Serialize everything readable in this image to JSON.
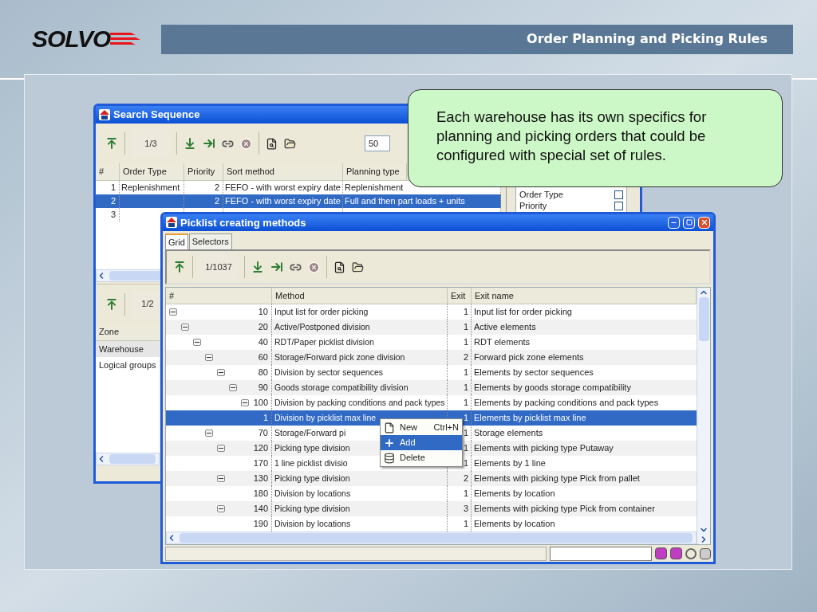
{
  "slide": {
    "logo": "SOLVO",
    "title": "Order Planning and Picking Rules"
  },
  "callout": {
    "text": "Each warehouse has its own specifics for planning and picking orders that could be configured with special set of rules."
  },
  "search_window": {
    "title": "Search Sequence",
    "counter": "1/3",
    "count_field": "50",
    "columns": [
      "#",
      "Order Type",
      "Priority",
      "Sort method",
      "Planning type"
    ],
    "rows": [
      {
        "number": "1",
        "order_type": "Replenishment",
        "priority": "2",
        "sort_method": "FEFO - with worst expiry date",
        "planning_type": "Replenishment",
        "selected": false
      },
      {
        "number": "2",
        "priority": "2",
        "sort_method": "FEFO - with worst expiry date",
        "planning_type": "Full and then part loads + units",
        "selected": true
      },
      {
        "number": "3",
        "selected": false
      }
    ],
    "side_fields": [
      {
        "label": "Order Type",
        "checked": false
      },
      {
        "label": "Priority",
        "checked": false
      }
    ],
    "lower": {
      "counter": "1/2",
      "column": "Zone",
      "items": [
        {
          "label": "Warehouse",
          "selected": true
        },
        {
          "label": "Logical groups",
          "selected": false
        }
      ]
    }
  },
  "picklist_window": {
    "title": "Picklist creating methods",
    "tabs": [
      {
        "label": "Grid",
        "selected": true
      },
      {
        "label": "Selectors",
        "selected": false
      }
    ],
    "counter": "1/1037",
    "columns": [
      "#",
      "Method",
      "Exit",
      "Exit name"
    ],
    "rows": [
      {
        "number": "10",
        "method": "Input list for order picking",
        "exit": "1",
        "exit_name": "Input list for order picking",
        "selected": false,
        "expanded": true,
        "children": [
          {
            "number": "20",
            "method": "Active/Postponed division",
            "exit": "1",
            "exit_name": "Active elements",
            "selected": false,
            "expanded": true,
            "children": [
              {
                "number": "40",
                "method": "RDT/Paper picklist division",
                "exit": "1",
                "exit_name": "RDT elements",
                "selected": false,
                "expanded": true,
                "children": [
                  {
                    "number": "60",
                    "method": "Storage/Forward pick zone division",
                    "exit": "2",
                    "exit_name": "Forward pick zone elements",
                    "selected": false,
                    "expanded": true,
                    "children": [
                      {
                        "number": "80",
                        "method": "Division by sector sequences",
                        "exit": "1",
                        "exit_name": "Elements by sector sequences",
                        "selected": false,
                        "expanded": true,
                        "children": [
                          {
                            "number": "90",
                            "method": "Goods storage compatibility division",
                            "exit": "1",
                            "exit_name": "Elements by goods storage compatibility",
                            "selected": false,
                            "expanded": true,
                            "children": [
                              {
                                "number": "100",
                                "method": "Division by packing conditions and pack types",
                                "exit": "1",
                                "exit_name": "Elements by packing conditions and pack types",
                                "selected": false,
                                "expanded": true,
                                "children": [
                                  {
                                    "number": "1",
                                    "method": "Division by picklist max line",
                                    "exit": "1",
                                    "exit_name": "Elements by picklist max line",
                                    "selected": true
                                  }
                                ]
                              }
                            ]
                          }
                        ]
                      }
                    ]
                  },
                  {
                    "number": "70",
                    "method": "Storage/Forward pi",
                    "exit": "1",
                    "exit_name": "Storage elements",
                    "selected": false,
                    "expanded": true,
                    "children": [
                      {
                        "number": "120",
                        "method": "Picking type division",
                        "exit": "1",
                        "exit_name": "Elements with picking type Putaway",
                        "selected": false,
                        "expanded": true,
                        "children": [
                          {
                            "number": "170",
                            "method": "1 line picklist divisio",
                            "exit": "1",
                            "exit_name": "Elements by 1 line",
                            "selected": false
                          }
                        ]
                      },
                      {
                        "number": "130",
                        "method": "Picking type division",
                        "exit": "2",
                        "exit_name": "Elements with picking type Pick from pallet",
                        "selected": false,
                        "expanded": true,
                        "children": [
                          {
                            "number": "180",
                            "method": "Division by locations",
                            "exit": "1",
                            "exit_name": "Elements by location",
                            "selected": false
                          }
                        ]
                      },
                      {
                        "number": "140",
                        "method": "Picking type division",
                        "exit": "3",
                        "exit_name": "Elements with picking type Pick from container",
                        "selected": false,
                        "expanded": true,
                        "children": [
                          {
                            "number": "190",
                            "method": "Division by locations",
                            "exit": "1",
                            "exit_name": "Elements by location",
                            "selected": false
                          }
                        ]
                      }
                    ]
                  }
                ]
              }
            ]
          }
        ]
      }
    ],
    "context_menu": [
      {
        "label": "New",
        "shortcut": "Ctrl+N",
        "kind": "new",
        "selected": false
      },
      {
        "label": "Add",
        "kind": "add",
        "selected": true
      },
      {
        "label": "Delete",
        "kind": "delete",
        "selected": false
      }
    ]
  }
}
